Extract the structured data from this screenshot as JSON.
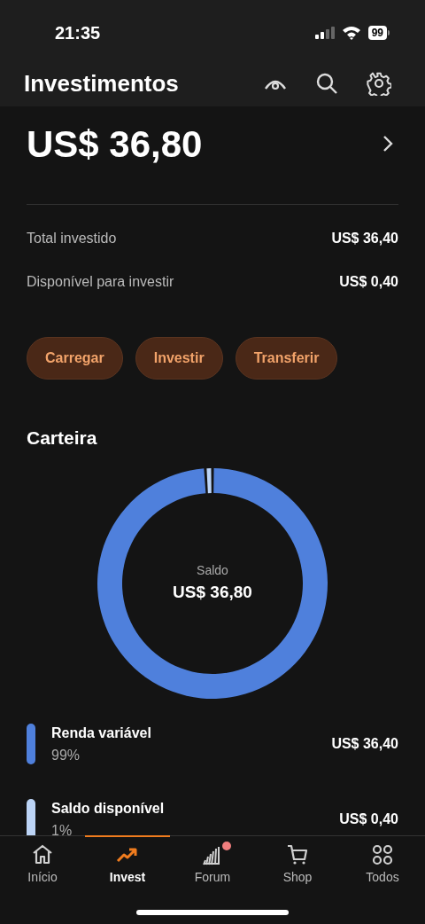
{
  "status_bar": {
    "time": "21:35",
    "battery": "99"
  },
  "header": {
    "title": "Investimentos"
  },
  "balance": {
    "amount": "US$ 36,80"
  },
  "summary": [
    {
      "label": "Total investido",
      "value": "US$ 36,40"
    },
    {
      "label": "Disponível para investir",
      "value": "US$ 0,40"
    }
  ],
  "actions": [
    "Carregar",
    "Investir",
    "Transferir"
  ],
  "portfolio": {
    "title": "Carteira",
    "center_label": "Saldo",
    "center_value": "US$ 36,80",
    "chart_data": {
      "type": "donut",
      "categories": [
        "Renda variável",
        "Saldo disponível"
      ],
      "series": [
        {
          "values": [
            99,
            1
          ]
        }
      ]
    },
    "items": [
      {
        "percent": "99%",
        "value": "US$ 36,40",
        "color": "#4f80dc"
      },
      {
        "percent": "1%",
        "value": "US$ 0,40",
        "color": "#bcd4f6"
      }
    ]
  },
  "nav": [
    {
      "label": "Início",
      "selected": false,
      "badge": false
    },
    {
      "label": "Invest",
      "selected": true,
      "badge": false
    },
    {
      "label": "Forum",
      "selected": false,
      "badge": true
    },
    {
      "label": "Shop",
      "selected": false,
      "badge": false
    },
    {
      "label": "Todos",
      "selected": false,
      "badge": false
    }
  ]
}
